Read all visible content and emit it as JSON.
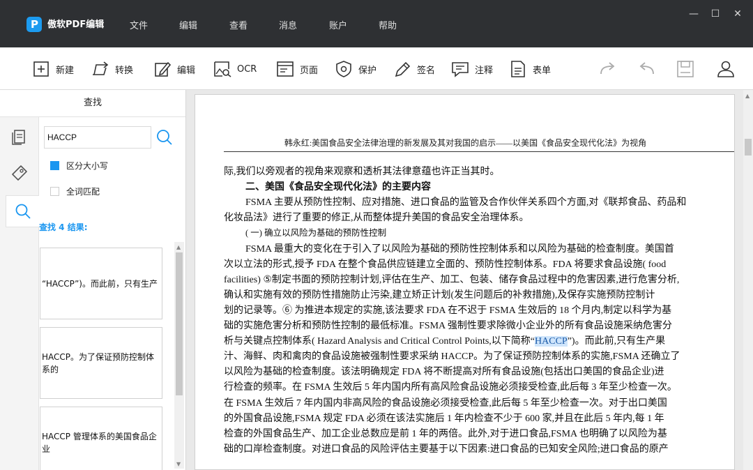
{
  "app": {
    "logo_letter": "P",
    "name": "傲软PDF编辑"
  },
  "menu": [
    "文件",
    "编辑",
    "查看",
    "消息",
    "账户",
    "帮助"
  ],
  "window_controls": {
    "minimize": "—",
    "maximize": "☐",
    "close": "✕"
  },
  "toolbar": {
    "tools": [
      {
        "label": "新建",
        "icon": "plus-square-icon"
      },
      {
        "label": "转换",
        "icon": "convert-icon"
      },
      {
        "label": "编辑",
        "icon": "edit-icon"
      },
      {
        "label": "OCR",
        "icon": "ocr-icon"
      },
      {
        "label": "页面",
        "icon": "page-icon"
      },
      {
        "label": "保护",
        "icon": "shield-icon"
      },
      {
        "label": "签名",
        "icon": "pen-icon"
      },
      {
        "label": "注释",
        "icon": "comment-icon"
      },
      {
        "label": "表单",
        "icon": "form-icon"
      }
    ],
    "right_icons": [
      "redo-icon",
      "undo-icon",
      "save-icon",
      "user-icon"
    ]
  },
  "search_panel": {
    "title": "查找",
    "query": "HACCP",
    "options": [
      {
        "label": "区分大小写",
        "checked": true
      },
      {
        "label": "全词匹配",
        "checked": false
      }
    ],
    "result_count": "查找 4 结果:",
    "results": [
      "“HACCP”)。而此前，只有生产",
      "HACCP。为了保证预防控制体系的",
      "HACCP 管理体系的美国食品企业"
    ]
  },
  "document": {
    "header": "韩永红:美国食品安全法律治理的新发展及其对我国的启示——以美国《食品安全现代化法》为视角",
    "lines": [
      {
        "t": "际,我们以旁观者的视角来观察和透析其法律意蕴也许正当其时。",
        "s": "plain"
      },
      {
        "t": "二、美国《食品安全现代化法》的主要内容",
        "s": "bold-indent"
      },
      {
        "t": "FSMA 主要从预防性控制、应对措施、进口食品的监管及合作伙伴关系四个方面,对《联邦食品、药品和",
        "s": "indent"
      },
      {
        "t": "化妆品法》进行了重要的修正,从而整体提升美国的食品安全治理体系。",
        "s": "plain"
      },
      {
        "t": "( 一) 确立以风险为基础的预防性控制",
        "s": "small-indent"
      },
      {
        "t": "FSMA 最重大的变化在于引入了以风险为基础的预防性控制体系和以风险为基础的检查制度。美国首",
        "s": "indent"
      },
      {
        "t": "次以立法的形式,授予 FDA 在整个食品供应链建立全面的、预防性控制体系。FDA 将要求食品设施( food",
        "s": "plain"
      },
      {
        "t": "facilities) ⑤制定书面的预防控制计划,评估在生产、加工、包装、储存食品过程中的危害因素,进行危害分析,",
        "s": "plain"
      },
      {
        "t": "确认和实施有效的预防性措施防止污染,建立矫正计划(发生问题后的补救措施),及保存实施预防控制计",
        "s": "plain"
      },
      {
        "t": "划的记录等。⑥ 为推进本规定的实施,该法要求 FDA 在不迟于 FSMA 生效后的 18 个月内,制定以科学为基",
        "s": "plain"
      },
      {
        "t": "础的实施危害分析和预防性控制的最低标准。FSMA 强制性要求除微小企业外的所有食品设施采纳危害分",
        "s": "plain"
      },
      {
        "t": "析与关键点控制体系( Hazard Analysis and Critical Control Points,以下简称“",
        "hl": "HACCP",
        "after": "”)。而此前,只有生产果",
        "s": "plain"
      },
      {
        "t": "汁、海鲜、肉和禽肉的食品设施被强制性要求采纳 HACCP。为了保证预防控制体系的实施,FSMA 还确立了",
        "s": "plain"
      },
      {
        "t": "以风险为基础的检查制度。该法明确规定 FDA 将不断提高对所有食品设施(包括出口美国的食品企业)进",
        "s": "plain"
      },
      {
        "t": "行检查的频率。在 FSMA 生效后 5 年内国内所有高风险食品设施必须接受检查,此后每 3 年至少检查一次。",
        "s": "plain"
      },
      {
        "t": "在 FSMA 生效后 7 年内国内非高风险的食品设施必须接受检查,此后每 5 年至少检查一次。对于出口美国",
        "s": "plain"
      },
      {
        "t": "的外国食品设施,FSMA 规定 FDA 必须在该法实施后 1 年内检查不少于 600 家,并且在此后 5 年内,每 1 年",
        "s": "plain"
      },
      {
        "t": "检查的外国食品生产、加工企业总数应是前 1 年的两倍。此外,对于进口食品,FSMA 也明确了以风险为基",
        "s": "plain"
      },
      {
        "t": "础的口岸检查制度。对进口食品的风险评估主要基于以下因素:进口食品的已知安全风险;进口食品的原产",
        "s": "plain"
      }
    ]
  }
}
